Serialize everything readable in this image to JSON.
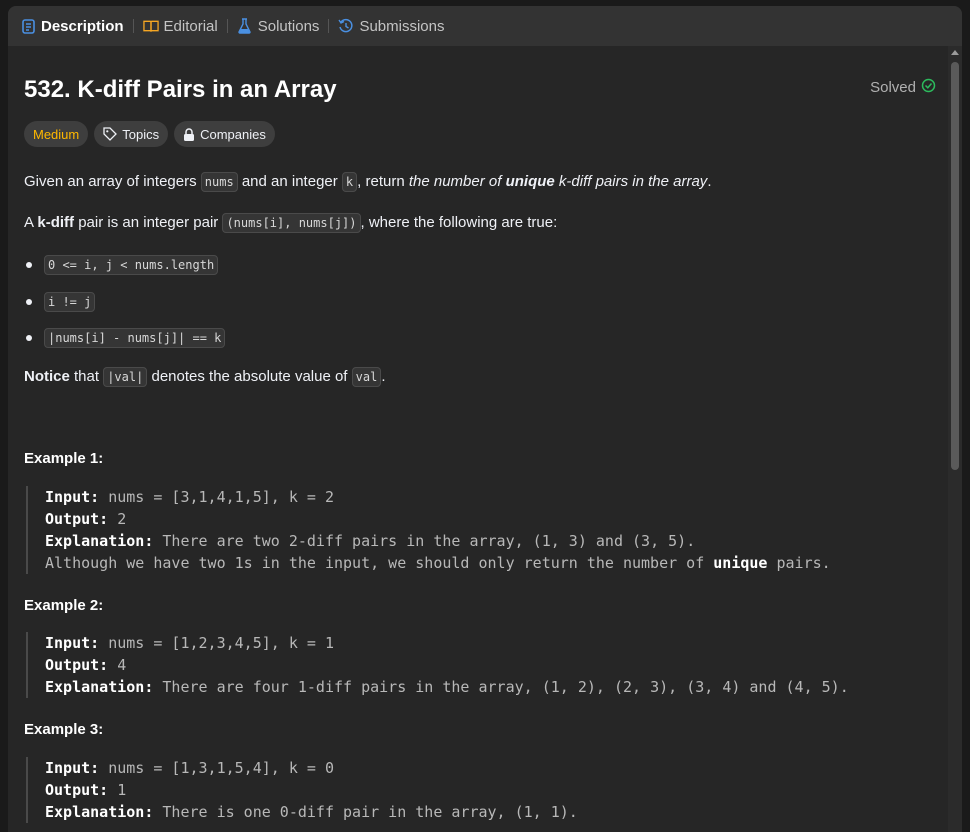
{
  "tabs": [
    {
      "label": "Description",
      "icon": "description-icon"
    },
    {
      "label": "Editorial",
      "icon": "book-icon"
    },
    {
      "label": "Solutions",
      "icon": "flask-icon"
    },
    {
      "label": "Submissions",
      "icon": "history-icon"
    }
  ],
  "problem": {
    "title": "532. K-diff Pairs in an Array",
    "status": "Solved",
    "difficulty": "Medium",
    "topics_label": "Topics",
    "companies_label": "Companies"
  },
  "desc": {
    "p1_a": "Given an array of integers ",
    "p1_code1": "nums",
    "p1_b": " and an integer ",
    "p1_code2": "k",
    "p1_c": ", return ",
    "p1_i1": "the number of ",
    "p1_bi": "unique",
    "p1_i2": " k-diff pairs in the array",
    "p1_d": ".",
    "p2_a": "A ",
    "p2_b": "k-diff",
    "p2_c": " pair is an integer pair ",
    "p2_code": "(nums[i], nums[j])",
    "p2_d": ", where the following are true:",
    "bullets": [
      "0 <= i, j < nums.length",
      "i != j",
      "|nums[i] - nums[j]| == k"
    ],
    "notice_b": "Notice",
    "notice_a": " that ",
    "notice_code1": "|val|",
    "notice_c": " denotes the absolute value of ",
    "notice_code2": "val",
    "notice_d": "."
  },
  "examples": [
    {
      "heading": "Example 1:",
      "input_label": "Input:",
      "input": " nums = [3,1,4,1,5], k = 2",
      "output_label": "Output:",
      "output": " 2",
      "expl_label": "Explanation:",
      "expl": " There are two 2-diff pairs in the array, (1, 3) and (3, 5).",
      "expl2_a": "Although we have two 1s in the input, we should only return the number of ",
      "expl2_b": "unique",
      "expl2_c": " pairs."
    },
    {
      "heading": "Example 2:",
      "input_label": "Input:",
      "input": " nums = [1,2,3,4,5], k = 1",
      "output_label": "Output:",
      "output": " 4",
      "expl_label": "Explanation:",
      "expl": " There are four 1-diff pairs in the array, (1, 2), (2, 3), (3, 4) and (4, 5)."
    },
    {
      "heading": "Example 3:",
      "input_label": "Input:",
      "input": " nums = [1,3,1,5,4], k = 0",
      "output_label": "Output:",
      "output": " 1",
      "expl_label": "Explanation:",
      "expl": " There is one 0-diff pair in the array, (1, 1)."
    }
  ],
  "colors": {
    "medium": "#ffb800",
    "solved_check": "#2cbb5d",
    "tab_active_icon": "#4a90e2"
  }
}
